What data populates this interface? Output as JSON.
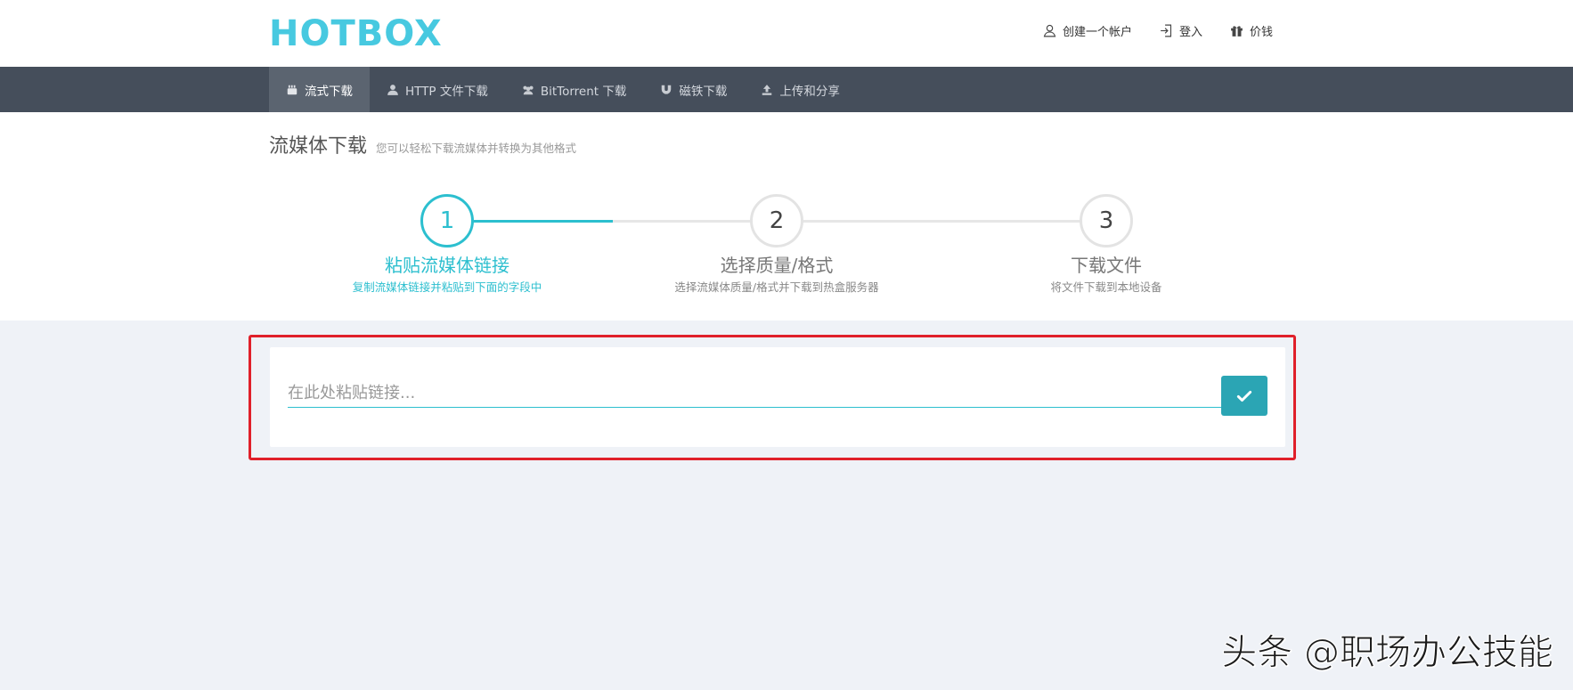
{
  "brand": {
    "logo": "HOTBOX",
    "color": "#47c9e0"
  },
  "top_links": [
    {
      "label": "创建一个帐户",
      "icon": "user-icon"
    },
    {
      "label": "登入",
      "icon": "login-icon"
    },
    {
      "label": "价钱",
      "icon": "gift-icon"
    }
  ],
  "nav": {
    "items": [
      {
        "label": "流式下载",
        "icon": "youtube-icon",
        "active": true
      },
      {
        "label": "HTTP 文件下载",
        "icon": "user-icon",
        "active": false
      },
      {
        "label": "BitTorrent 下载",
        "icon": "users-icon",
        "active": false
      },
      {
        "label": "磁铁下载",
        "icon": "magnet-icon",
        "active": false
      },
      {
        "label": "上传和分享",
        "icon": "upload-icon",
        "active": false
      }
    ]
  },
  "page": {
    "title": "流媒体下载",
    "subtitle": "您可以轻松下载流媒体并转换为其他格式"
  },
  "steps": [
    {
      "number": "1",
      "title": "粘贴流媒体链接",
      "desc": "复制流媒体链接并粘贴到下面的字段中",
      "active": true
    },
    {
      "number": "2",
      "title": "选择质量/格式",
      "desc": "选择流媒体质量/格式并下载到热盒服务器",
      "active": false
    },
    {
      "number": "3",
      "title": "下载文件",
      "desc": "将文件下载到本地设备",
      "active": false
    }
  ],
  "link_input": {
    "placeholder": "在此处粘贴链接...",
    "value": ""
  },
  "submit": {
    "icon": "check-icon"
  },
  "watermark": "头条 @职场办公技能",
  "colors": {
    "accent": "#2cbfcf",
    "nav_bg": "#454e5b",
    "highlight": "#e0202a",
    "button": "#2ba5b4"
  }
}
